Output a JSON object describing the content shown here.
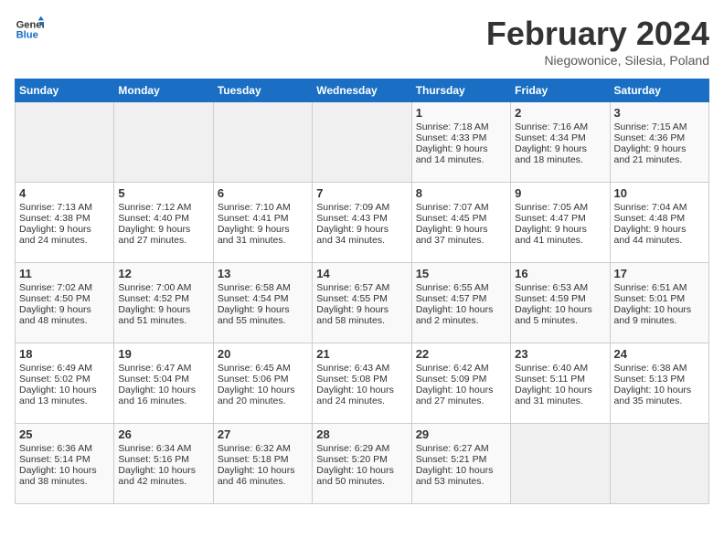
{
  "header": {
    "logo_line1": "General",
    "logo_line2": "Blue",
    "month": "February 2024",
    "location": "Niegowonice, Silesia, Poland"
  },
  "days_of_week": [
    "Sunday",
    "Monday",
    "Tuesday",
    "Wednesday",
    "Thursday",
    "Friday",
    "Saturday"
  ],
  "weeks": [
    [
      {
        "day": "",
        "info": ""
      },
      {
        "day": "",
        "info": ""
      },
      {
        "day": "",
        "info": ""
      },
      {
        "day": "",
        "info": ""
      },
      {
        "day": "1",
        "info": "Sunrise: 7:18 AM\nSunset: 4:33 PM\nDaylight: 9 hours\nand 14 minutes."
      },
      {
        "day": "2",
        "info": "Sunrise: 7:16 AM\nSunset: 4:34 PM\nDaylight: 9 hours\nand 18 minutes."
      },
      {
        "day": "3",
        "info": "Sunrise: 7:15 AM\nSunset: 4:36 PM\nDaylight: 9 hours\nand 21 minutes."
      }
    ],
    [
      {
        "day": "4",
        "info": "Sunrise: 7:13 AM\nSunset: 4:38 PM\nDaylight: 9 hours\nand 24 minutes."
      },
      {
        "day": "5",
        "info": "Sunrise: 7:12 AM\nSunset: 4:40 PM\nDaylight: 9 hours\nand 27 minutes."
      },
      {
        "day": "6",
        "info": "Sunrise: 7:10 AM\nSunset: 4:41 PM\nDaylight: 9 hours\nand 31 minutes."
      },
      {
        "day": "7",
        "info": "Sunrise: 7:09 AM\nSunset: 4:43 PM\nDaylight: 9 hours\nand 34 minutes."
      },
      {
        "day": "8",
        "info": "Sunrise: 7:07 AM\nSunset: 4:45 PM\nDaylight: 9 hours\nand 37 minutes."
      },
      {
        "day": "9",
        "info": "Sunrise: 7:05 AM\nSunset: 4:47 PM\nDaylight: 9 hours\nand 41 minutes."
      },
      {
        "day": "10",
        "info": "Sunrise: 7:04 AM\nSunset: 4:48 PM\nDaylight: 9 hours\nand 44 minutes."
      }
    ],
    [
      {
        "day": "11",
        "info": "Sunrise: 7:02 AM\nSunset: 4:50 PM\nDaylight: 9 hours\nand 48 minutes."
      },
      {
        "day": "12",
        "info": "Sunrise: 7:00 AM\nSunset: 4:52 PM\nDaylight: 9 hours\nand 51 minutes."
      },
      {
        "day": "13",
        "info": "Sunrise: 6:58 AM\nSunset: 4:54 PM\nDaylight: 9 hours\nand 55 minutes."
      },
      {
        "day": "14",
        "info": "Sunrise: 6:57 AM\nSunset: 4:55 PM\nDaylight: 9 hours\nand 58 minutes."
      },
      {
        "day": "15",
        "info": "Sunrise: 6:55 AM\nSunset: 4:57 PM\nDaylight: 10 hours\nand 2 minutes."
      },
      {
        "day": "16",
        "info": "Sunrise: 6:53 AM\nSunset: 4:59 PM\nDaylight: 10 hours\nand 5 minutes."
      },
      {
        "day": "17",
        "info": "Sunrise: 6:51 AM\nSunset: 5:01 PM\nDaylight: 10 hours\nand 9 minutes."
      }
    ],
    [
      {
        "day": "18",
        "info": "Sunrise: 6:49 AM\nSunset: 5:02 PM\nDaylight: 10 hours\nand 13 minutes."
      },
      {
        "day": "19",
        "info": "Sunrise: 6:47 AM\nSunset: 5:04 PM\nDaylight: 10 hours\nand 16 minutes."
      },
      {
        "day": "20",
        "info": "Sunrise: 6:45 AM\nSunset: 5:06 PM\nDaylight: 10 hours\nand 20 minutes."
      },
      {
        "day": "21",
        "info": "Sunrise: 6:43 AM\nSunset: 5:08 PM\nDaylight: 10 hours\nand 24 minutes."
      },
      {
        "day": "22",
        "info": "Sunrise: 6:42 AM\nSunset: 5:09 PM\nDaylight: 10 hours\nand 27 minutes."
      },
      {
        "day": "23",
        "info": "Sunrise: 6:40 AM\nSunset: 5:11 PM\nDaylight: 10 hours\nand 31 minutes."
      },
      {
        "day": "24",
        "info": "Sunrise: 6:38 AM\nSunset: 5:13 PM\nDaylight: 10 hours\nand 35 minutes."
      }
    ],
    [
      {
        "day": "25",
        "info": "Sunrise: 6:36 AM\nSunset: 5:14 PM\nDaylight: 10 hours\nand 38 minutes."
      },
      {
        "day": "26",
        "info": "Sunrise: 6:34 AM\nSunset: 5:16 PM\nDaylight: 10 hours\nand 42 minutes."
      },
      {
        "day": "27",
        "info": "Sunrise: 6:32 AM\nSunset: 5:18 PM\nDaylight: 10 hours\nand 46 minutes."
      },
      {
        "day": "28",
        "info": "Sunrise: 6:29 AM\nSunset: 5:20 PM\nDaylight: 10 hours\nand 50 minutes."
      },
      {
        "day": "29",
        "info": "Sunrise: 6:27 AM\nSunset: 5:21 PM\nDaylight: 10 hours\nand 53 minutes."
      },
      {
        "day": "",
        "info": ""
      },
      {
        "day": "",
        "info": ""
      }
    ]
  ]
}
